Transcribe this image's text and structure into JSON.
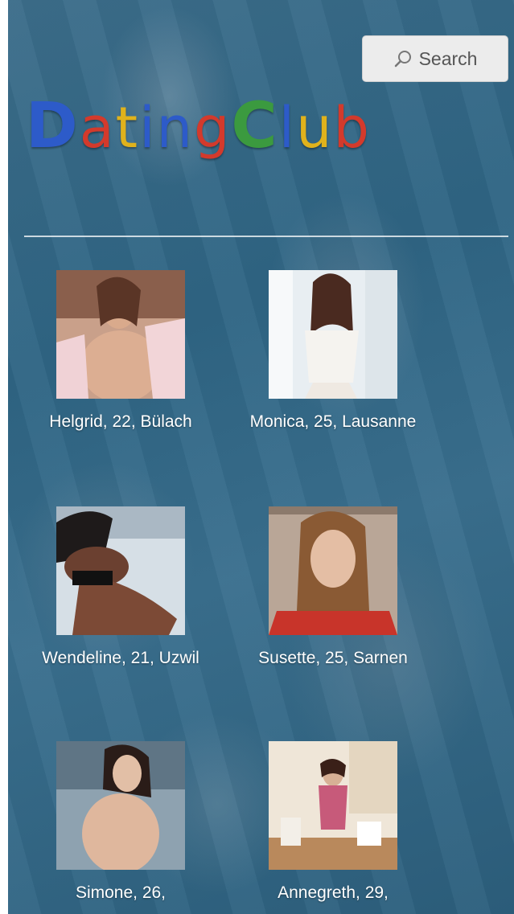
{
  "search": {
    "label": "Search"
  },
  "logo": {
    "letters": [
      "D",
      "a",
      "t",
      "i",
      "n",
      "g",
      "C",
      "l",
      "u",
      "b"
    ]
  },
  "profiles": [
    {
      "name": "Helgrid, 22, Bülach"
    },
    {
      "name": "Monica, 25, Lausanne"
    },
    {
      "name": "Wendeline, 21, Uzwil"
    },
    {
      "name": "Susette, 25, Sarnen"
    },
    {
      "name": "Simone, 26,"
    },
    {
      "name": "Annegreth, 29,"
    }
  ],
  "colors": {
    "logo_blue": "#2d5bc9",
    "logo_red": "#d33a2c",
    "logo_yellow": "#e0b21c",
    "logo_green": "#3b9a3f"
  }
}
